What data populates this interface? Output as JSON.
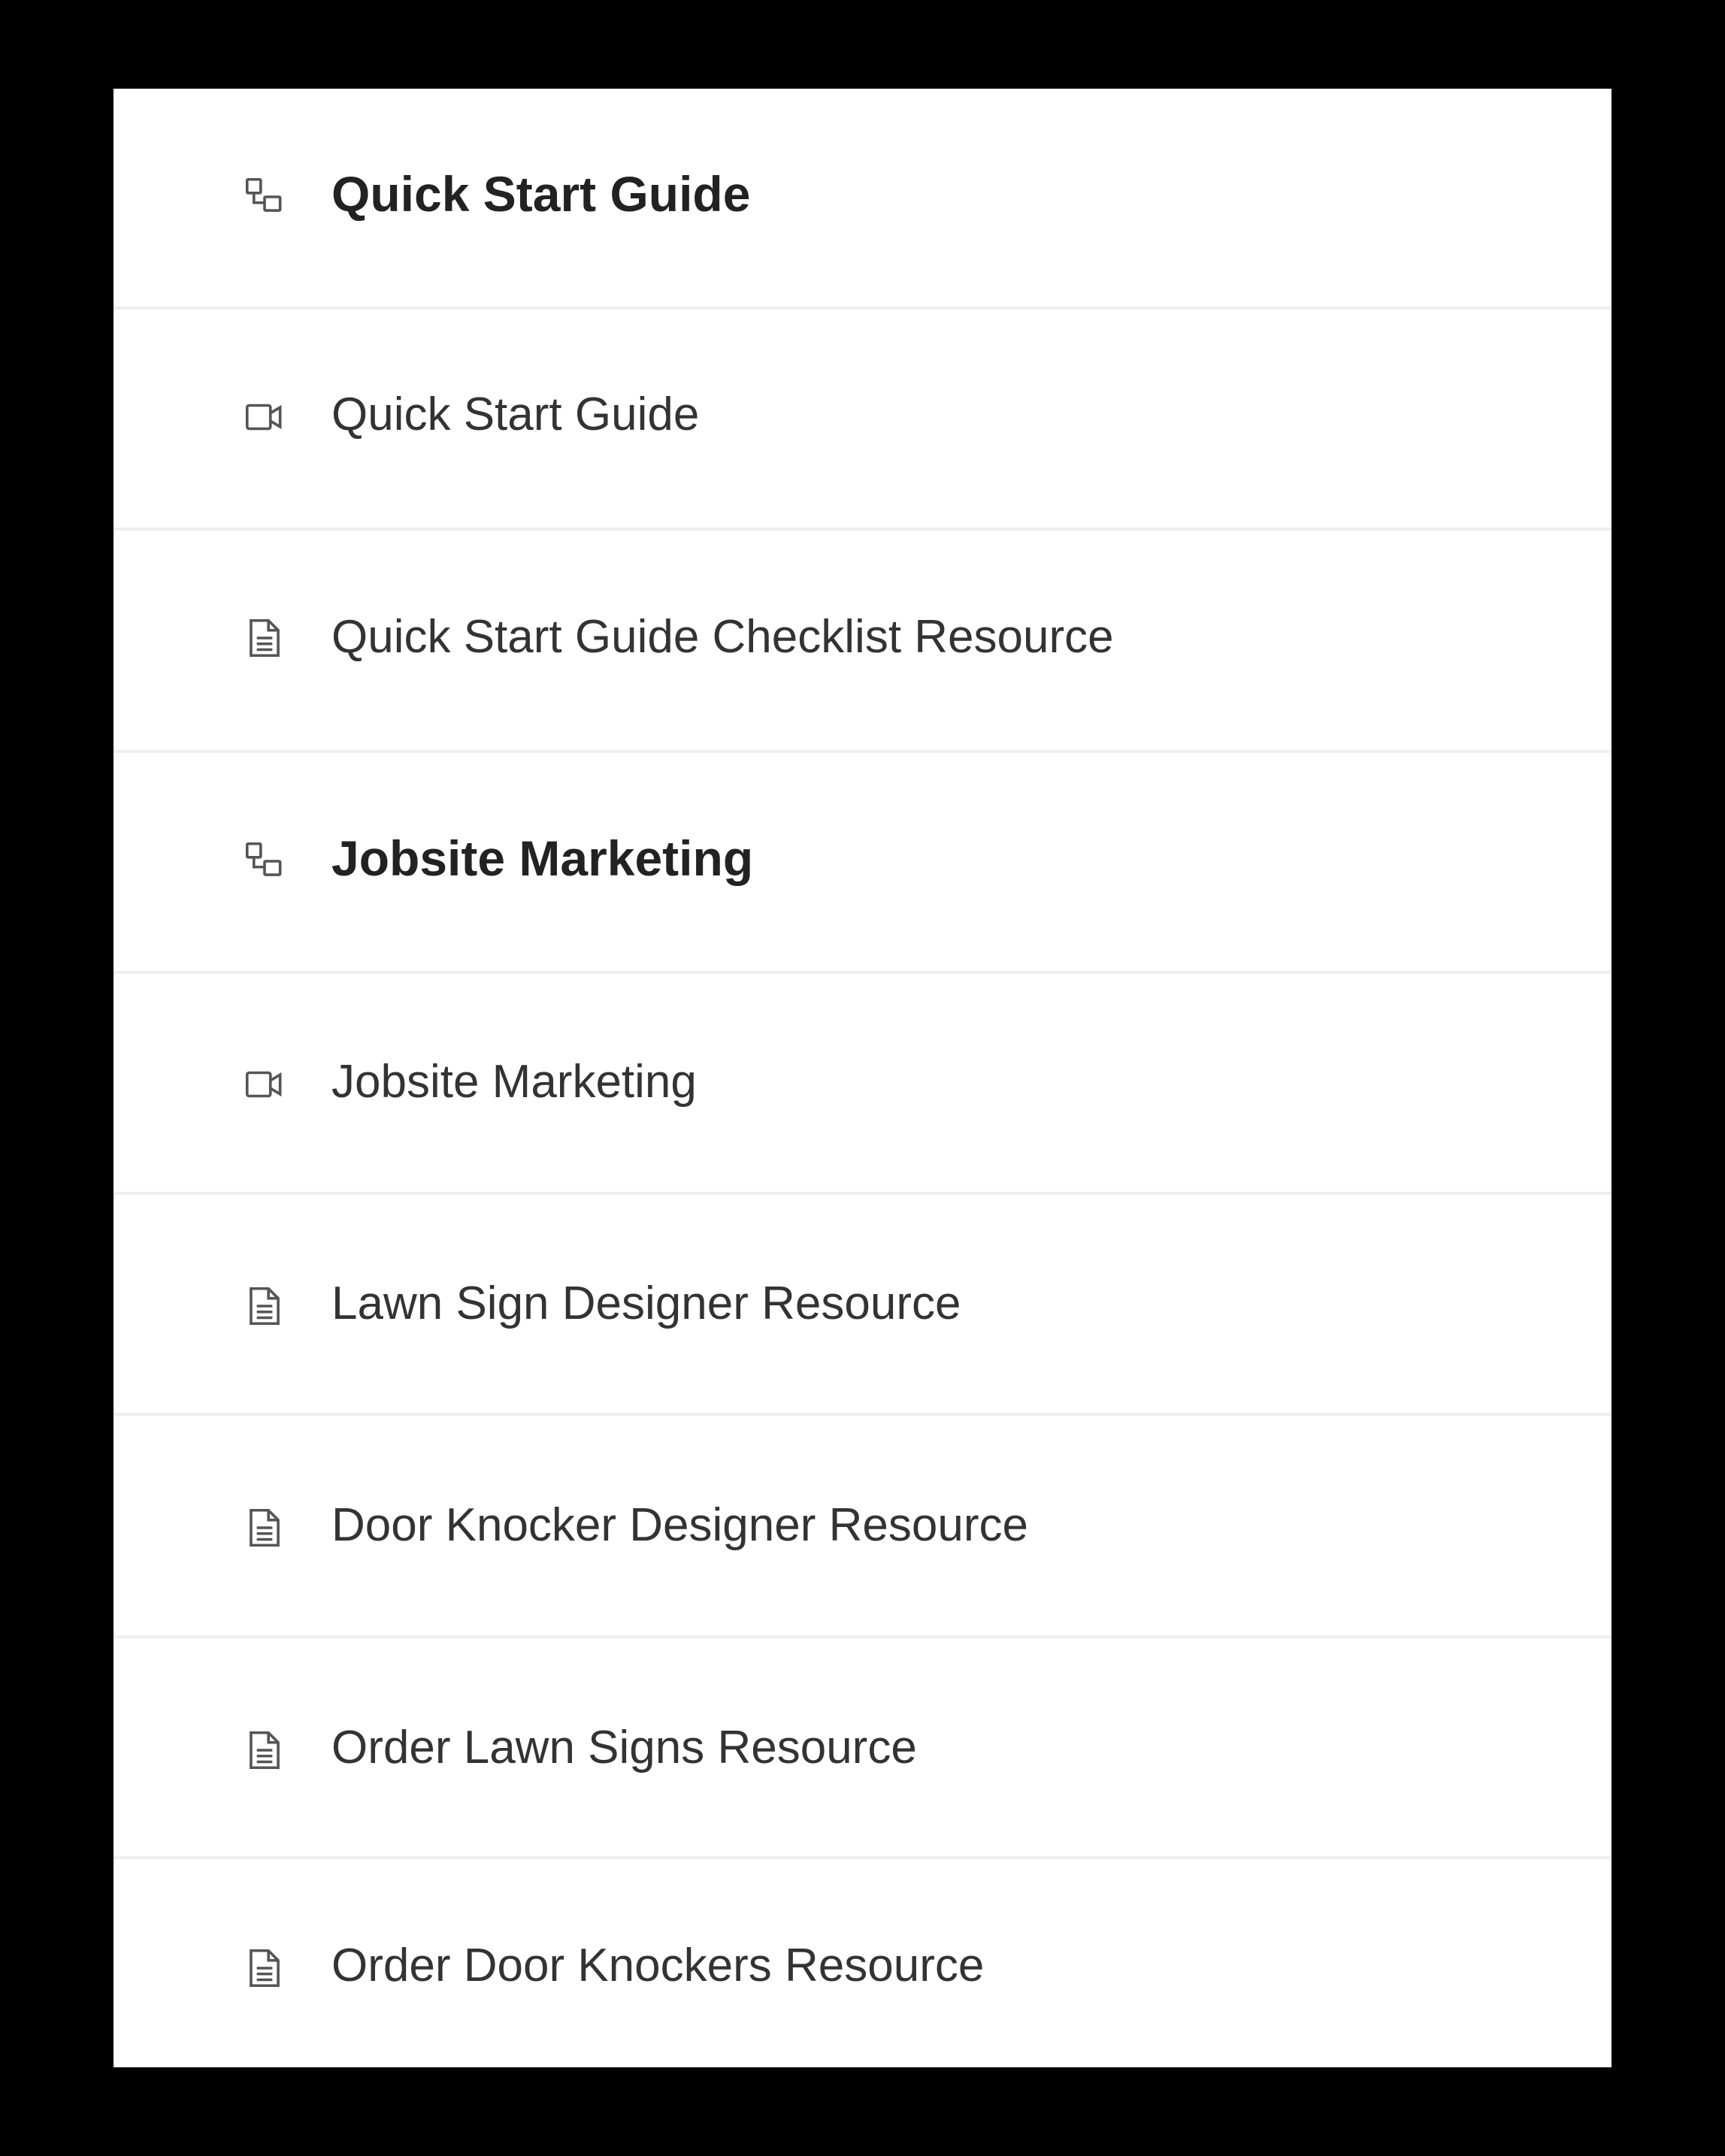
{
  "curriculum": {
    "items": [
      {
        "type": "section",
        "icon": "section-link-icon",
        "label": "Quick Start Guide"
      },
      {
        "type": "video",
        "icon": "video-icon",
        "label": "Quick Start Guide"
      },
      {
        "type": "document",
        "icon": "document-icon",
        "label": "Quick Start Guide Checklist Resource"
      },
      {
        "type": "section",
        "icon": "section-link-icon",
        "label": "Jobsite Marketing"
      },
      {
        "type": "video",
        "icon": "video-icon",
        "label": "Jobsite Marketing"
      },
      {
        "type": "document",
        "icon": "document-icon",
        "label": "Lawn Sign Designer Resource"
      },
      {
        "type": "document",
        "icon": "document-icon",
        "label": "Door Knocker Designer Resource"
      },
      {
        "type": "document",
        "icon": "document-icon",
        "label": "Order Lawn Signs Resource"
      },
      {
        "type": "document",
        "icon": "document-icon",
        "label": "Order Door Knockers Resource"
      }
    ]
  },
  "colors": {
    "background": "#000000",
    "panel": "#ffffff",
    "divider": "#eeeeee",
    "text": "#333333",
    "icon": "#555555"
  }
}
